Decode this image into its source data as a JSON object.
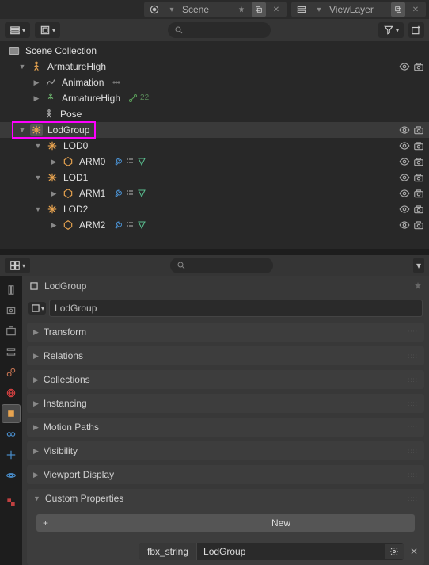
{
  "header": {
    "scene_label": "Scene",
    "viewlayer_label": "ViewLayer"
  },
  "search": {
    "outliner_placeholder": "",
    "props_placeholder": ""
  },
  "outliner": {
    "root": "Scene Collection",
    "items": [
      {
        "name": "ArmatureHigh",
        "type": "armature"
      },
      {
        "name": "Animation",
        "type": "anim"
      },
      {
        "name": "ArmatureHigh",
        "type": "armature-data",
        "count": "22"
      },
      {
        "name": "Pose",
        "type": "pose"
      },
      {
        "name": "LodGroup",
        "type": "empty",
        "highlighted": true
      },
      {
        "name": "LOD0",
        "type": "empty"
      },
      {
        "name": "ARM0",
        "type": "mesh"
      },
      {
        "name": "LOD1",
        "type": "empty"
      },
      {
        "name": "ARM1",
        "type": "mesh"
      },
      {
        "name": "LOD2",
        "type": "empty"
      },
      {
        "name": "ARM2",
        "type": "mesh"
      }
    ]
  },
  "properties": {
    "breadcrumb_name": "LodGroup",
    "name_field": "LodGroup",
    "panels": [
      {
        "title": "Transform",
        "expanded": false
      },
      {
        "title": "Relations",
        "expanded": false
      },
      {
        "title": "Collections",
        "expanded": false
      },
      {
        "title": "Instancing",
        "expanded": false
      },
      {
        "title": "Motion Paths",
        "expanded": false
      },
      {
        "title": "Visibility",
        "expanded": false
      },
      {
        "title": "Viewport Display",
        "expanded": false
      },
      {
        "title": "Custom Properties",
        "expanded": true
      }
    ],
    "new_button": "New",
    "custom_prop": {
      "key": "fbx_string",
      "value": "LodGroup"
    }
  }
}
